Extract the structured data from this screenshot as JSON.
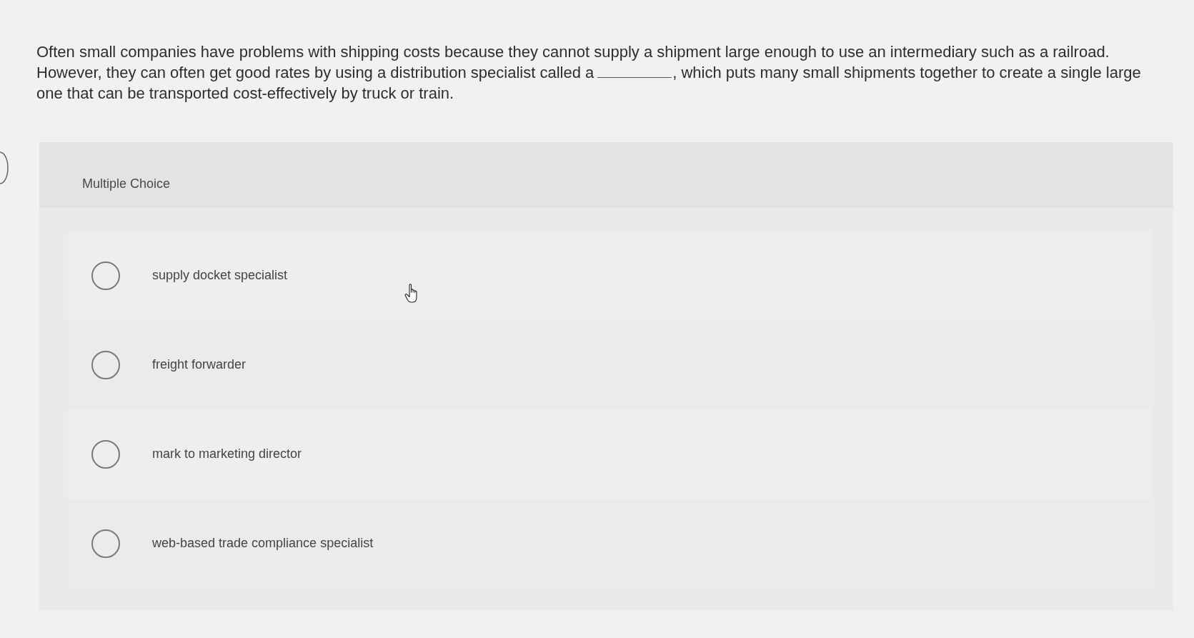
{
  "question": {
    "before_blank": "Often small companies have problems with shipping costs because they cannot supply a shipment large enough to use an intermediary such as a railroad. However, they can often get good rates by using a distribution specialist called a",
    "after_blank": ", which puts many small shipments together to create a single large one that can be transported cost-effectively by truck or train."
  },
  "multiple_choice": {
    "label": "Multiple Choice",
    "options": [
      {
        "text": "supply docket specialist",
        "selected": false
      },
      {
        "text": "freight forwarder",
        "selected": false
      },
      {
        "text": "mark to marketing director",
        "selected": false
      },
      {
        "text": "web-based trade compliance specialist",
        "selected": false
      }
    ]
  }
}
